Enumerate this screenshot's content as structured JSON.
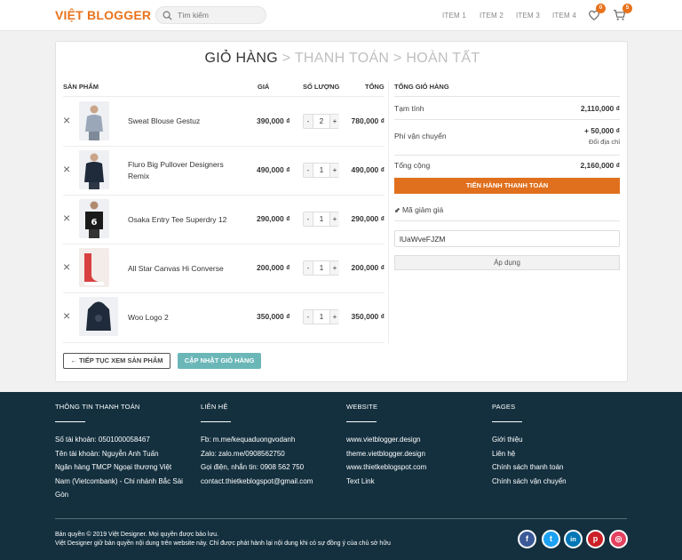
{
  "header": {
    "logo": "VIỆT BLOGGER",
    "search_placeholder": "Tìm kiếm",
    "nav": [
      "ITEM 1",
      "ITEM 2",
      "ITEM 3",
      "ITEM 4"
    ],
    "wishlist_count": "0",
    "cart_count": "5",
    "accent": "#e8731c"
  },
  "steps": {
    "cart": "GIỎ HÀNG",
    "sep": ">",
    "checkout": "THANH TOÁN",
    "done": "HOÀN TẤT"
  },
  "cart": {
    "headers": {
      "product": "SẢN PHẨM",
      "price": "GIÁ",
      "qty": "SỐ LƯỢNG",
      "total": "TỔNG"
    },
    "remove_symbol": "×",
    "minus": "-",
    "plus": "+",
    "items": [
      {
        "name": "Sweat Blouse Gestuz",
        "price": "390,000 ₫",
        "qty": "2",
        "total": "780,000 ₫",
        "thumb": "blouse"
      },
      {
        "name": "Fluro Big Pullover Designers Remix",
        "price": "490,000 ₫",
        "qty": "1",
        "total": "490,000 ₫",
        "thumb": "pullover"
      },
      {
        "name": "Osaka Entry Tee Superdry 12",
        "price": "290,000 ₫",
        "qty": "1",
        "total": "290,000 ₫",
        "thumb": "tee"
      },
      {
        "name": "All Star Canvas Hi Converse",
        "price": "200,000 ₫",
        "qty": "1",
        "total": "200,000 ₫",
        "thumb": "shoes"
      },
      {
        "name": "Woo Logo 2",
        "price": "350,000 ₫",
        "qty": "1",
        "total": "350,000 ₫",
        "thumb": "hoodie"
      }
    ],
    "continue_label": "TIẾP TỤC XEM SẢN PHẨM",
    "update_label": "CẬP NHẬT GIỎ HÀNG"
  },
  "summary": {
    "title": "TỔNG GIỎ HÀNG",
    "subtotal_label": "Tạm tính",
    "subtotal": "2,110,000 ₫",
    "shipping_label": "Phí vận chuyển",
    "shipping": "+ 50,000 ₫",
    "change_address": "Đổi địa chỉ",
    "total_label": "Tổng cộng",
    "total": "2,160,000 ₫",
    "checkout_label": "TIẾN HÀNH THANH TOÁN",
    "coupon_title": "Mã giảm giá",
    "coupon_value": "lUaWveFJZM",
    "apply_label": "Áp dụng"
  },
  "footer": {
    "cols": [
      {
        "title": "THÔNG TIN THANH TOÁN",
        "lines": [
          "Số tài khoản: 0501000058467",
          "Tên tài khoản: Nguyễn Anh Tuấn",
          "Ngân hàng TMCP Ngoại thương Việt",
          "Nam (Vietcombank) - Chi nhánh Bắc Sài",
          "Gòn"
        ]
      },
      {
        "title": "LIÊN HỆ",
        "lines": [
          "Fb: m.me/kequaduongvodanh",
          "Zalo: zalo.me/0908562750",
          "Gọi điện, nhắn tin: 0908 562 750",
          "contact.thietkeblogspot@gmail.com"
        ]
      },
      {
        "title": "WEBSITE",
        "lines": [
          "www.vietblogger.design",
          "theme.vietblogger.design",
          "www.thietkeblogspot.com",
          "Text Link"
        ]
      },
      {
        "title": "PAGES",
        "lines": [
          "Giới thiệu",
          "Liên hệ",
          "Chính sách thanh toán",
          "Chính sách vận chuyển"
        ]
      }
    ],
    "copyright1": "Bản quyền © 2019 Việt Designer. Mọi quyền được bảo lưu.",
    "copyright2": "Việt Designer giữ bản quyền nội dung trên website này. Chỉ được phát hành lại nội dung khi có sự đồng ý của chủ sở hữu",
    "social": [
      {
        "icon": "facebook-icon",
        "glyph": "f",
        "color": "#3b5998"
      },
      {
        "icon": "twitter-icon",
        "glyph": "t",
        "color": "#1da1f2"
      },
      {
        "icon": "linkedin-icon",
        "glyph": "in",
        "color": "#0077b5"
      },
      {
        "icon": "pinterest-icon",
        "glyph": "p",
        "color": "#cb2027"
      },
      {
        "icon": "instagram-icon",
        "glyph": "◎",
        "color": "#e4405f"
      }
    ]
  }
}
